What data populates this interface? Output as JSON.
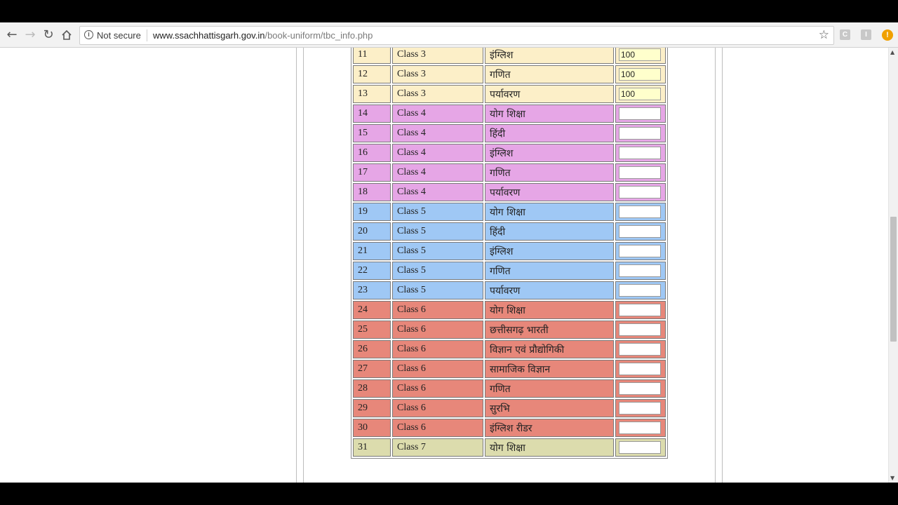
{
  "browser": {
    "back_icon": "arrow-left-icon",
    "forward_icon": "arrow-right-icon",
    "reload_icon": "reload-icon",
    "home_icon": "home-icon",
    "security_label": "Not secure",
    "url_host": "www.ssachhattisgarh.gov.in",
    "url_path": "/book-uniform/tbc_info.php",
    "star_icon": "star-icon",
    "extensions": [
      "C",
      "I"
    ],
    "alert_icon": "!"
  },
  "colors": {
    "class3": "#fcefc8",
    "class4": "#e6a6e6",
    "class5": "#9fc8f5",
    "class6": "#e7877a",
    "class7": "#dcdcad",
    "filled_input": "#ffffcc"
  },
  "table": {
    "rows": [
      {
        "no": "11",
        "class": "Class 3",
        "subject": "इंग्लिश",
        "qty": "100",
        "group": "class3"
      },
      {
        "no": "12",
        "class": "Class 3",
        "subject": "गणित",
        "qty": "100",
        "group": "class3"
      },
      {
        "no": "13",
        "class": "Class 3",
        "subject": "पर्यावरण",
        "qty": "100",
        "group": "class3"
      },
      {
        "no": "14",
        "class": "Class 4",
        "subject": "योग शिक्षा",
        "qty": "",
        "group": "class4"
      },
      {
        "no": "15",
        "class": "Class 4",
        "subject": "हिंदी",
        "qty": "",
        "group": "class4"
      },
      {
        "no": "16",
        "class": "Class 4",
        "subject": "इंग्लिश",
        "qty": "",
        "group": "class4"
      },
      {
        "no": "17",
        "class": "Class 4",
        "subject": "गणित",
        "qty": "",
        "group": "class4"
      },
      {
        "no": "18",
        "class": "Class 4",
        "subject": "पर्यावरण",
        "qty": "",
        "group": "class4"
      },
      {
        "no": "19",
        "class": "Class 5",
        "subject": "योग शिक्षा",
        "qty": "",
        "group": "class5"
      },
      {
        "no": "20",
        "class": "Class 5",
        "subject": "हिंदी",
        "qty": "",
        "group": "class5"
      },
      {
        "no": "21",
        "class": "Class 5",
        "subject": "इंग्लिश",
        "qty": "",
        "group": "class5"
      },
      {
        "no": "22",
        "class": "Class 5",
        "subject": "गणित",
        "qty": "",
        "group": "class5"
      },
      {
        "no": "23",
        "class": "Class 5",
        "subject": "पर्यावरण",
        "qty": "",
        "group": "class5"
      },
      {
        "no": "24",
        "class": "Class 6",
        "subject": "योग शिक्षा",
        "qty": "",
        "group": "class6"
      },
      {
        "no": "25",
        "class": "Class 6",
        "subject": "छत्तीसगढ़ भारती",
        "qty": "",
        "group": "class6"
      },
      {
        "no": "26",
        "class": "Class 6",
        "subject": "विज्ञान एवं प्रौद्योगिकी",
        "qty": "",
        "group": "class6"
      },
      {
        "no": "27",
        "class": "Class 6",
        "subject": "सामाजिक विज्ञान",
        "qty": "",
        "group": "class6"
      },
      {
        "no": "28",
        "class": "Class 6",
        "subject": "गणित",
        "qty": "",
        "group": "class6"
      },
      {
        "no": "29",
        "class": "Class 6",
        "subject": "सुरभि",
        "qty": "",
        "group": "class6"
      },
      {
        "no": "30",
        "class": "Class 6",
        "subject": "इंग्लिश रीडर",
        "qty": "",
        "group": "class6"
      },
      {
        "no": "31",
        "class": "Class 7",
        "subject": "योग शिक्षा",
        "qty": "",
        "group": "class7"
      }
    ]
  }
}
